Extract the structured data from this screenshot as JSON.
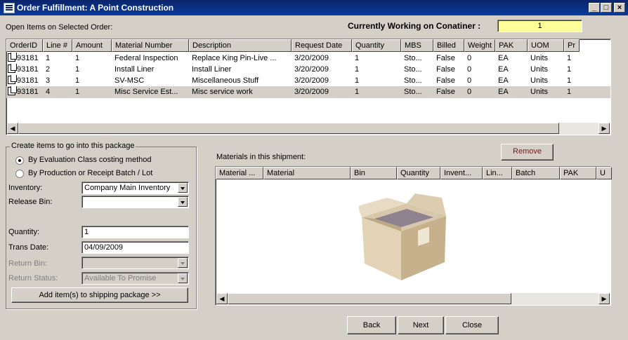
{
  "window": {
    "title": "Order Fulfillment:  A Point Construction",
    "minimize": "_",
    "maximize": "□",
    "close": "×"
  },
  "open_items_label": "Open Items on Selected Order:",
  "container": {
    "label": "Currently Working on Conatiner :",
    "value": "1"
  },
  "orders_table": {
    "columns": [
      "OrderID",
      "Line #",
      "Amount",
      "Material Number",
      "Description",
      "Request Date",
      "Quantity",
      "MBS",
      "Billed",
      "Weight",
      "PAK",
      "UOM",
      "Pr"
    ],
    "rows": [
      [
        "93181",
        "1",
        "1",
        "Federal Inspection",
        "Replace King Pin-Live ...",
        "3/20/2009",
        "1",
        "Sto...",
        "False",
        "0",
        "EA",
        "Units",
        "1"
      ],
      [
        "93181",
        "2",
        "1",
        "Install Liner",
        "Install  Liner",
        "3/20/2009",
        "1",
        "Sto...",
        "False",
        "0",
        "EA",
        "Units",
        "1"
      ],
      [
        "93181",
        "3",
        "1",
        "SV-MSC",
        "Miscellaneous Stuff",
        "3/20/2009",
        "1",
        "Sto...",
        "False",
        "0",
        "EA",
        "Units",
        "1"
      ],
      [
        "93181",
        "4",
        "1",
        "Misc Service Est...",
        "Misc service work",
        "3/20/2009",
        "1",
        "Sto...",
        "False",
        "0",
        "EA",
        "Units",
        "1"
      ]
    ]
  },
  "create_group": {
    "title": "Create items to go into this package",
    "radio1": "By Evaluation Class costing method",
    "radio2": "By Production or Receipt Batch / Lot",
    "inventory_label": "Inventory:",
    "inventory_value": "Company Main Inventory",
    "release_bin_label": "Release Bin:",
    "release_bin_value": "",
    "quantity_label": "Quantity:",
    "quantity_value": "1",
    "trans_date_label": "Trans Date:",
    "trans_date_value": "04/09/2009",
    "return_bin_label": "Return Bin:",
    "return_bin_value": "",
    "return_status_label": "Return Status:",
    "return_status_value": "Available To Promise",
    "add_button": "Add item(s) to shipping package >>"
  },
  "shipment": {
    "label": "Materials in this shipment:",
    "remove_button": "Remove",
    "columns": [
      "Material ...",
      "Material",
      "Bin",
      "Quantity",
      "Invent...",
      "Lin...",
      "Batch",
      "PAK",
      "U"
    ]
  },
  "nav": {
    "back": "Back",
    "next": "Next",
    "close": "Close"
  },
  "colors": {
    "titlebar": "#0a246a",
    "container_field": "#ffff99",
    "face": "#d4d0c8"
  }
}
